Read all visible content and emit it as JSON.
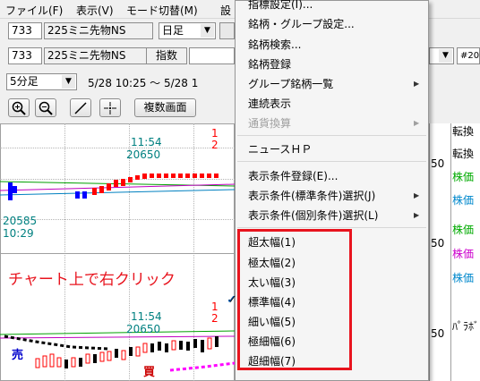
{
  "menubar": {
    "items": [
      "ファイル(F)",
      "表示(V)",
      "モード切替(M)",
      "設"
    ]
  },
  "toolbar1": {
    "code": "733",
    "name": "225ミニ先物NS",
    "period": "日足"
  },
  "toolbar2": {
    "code": "733",
    "name": "225ミニ先物NS",
    "type": "指数",
    "right_value": "#20"
  },
  "toolbar3": {
    "interval": "5分足",
    "range": "5/28 10:25 ～ 5/28 1"
  },
  "toolbar4": {
    "multi_screen": "複数画面"
  },
  "chart_top": {
    "time": "11:54",
    "price": "20650",
    "low_price": "20585",
    "low_time": "10:29",
    "side_value": "50",
    "side_value_2": "50",
    "red_char": "1",
    "red_char_2": "2"
  },
  "chart_bottom": {
    "time": "11:54",
    "price": "20650",
    "sell": "売",
    "buy": "買",
    "red_char": "1",
    "red_char_2": "2"
  },
  "annotation": "チャート上で右クリック",
  "context_menu": {
    "items": [
      {
        "label": "指標設定(I)...",
        "disabled": false,
        "submenu": false
      },
      {
        "label": "銘柄・グループ設定...",
        "disabled": false,
        "submenu": false
      },
      {
        "label": "銘柄検索...",
        "disabled": false,
        "submenu": false
      },
      {
        "label": "銘柄登録",
        "disabled": false,
        "submenu": false
      },
      {
        "label": "グループ銘柄一覧",
        "disabled": false,
        "submenu": true
      },
      {
        "label": "連続表示",
        "disabled": false,
        "submenu": false
      },
      {
        "label": "通貨換算",
        "disabled": true,
        "submenu": true
      },
      {
        "label": "ニュースＨＰ",
        "disabled": false,
        "submenu": false
      },
      {
        "label": "表示条件登録(E)...",
        "disabled": false,
        "submenu": false
      },
      {
        "label": "表示条件(標準条件)選択(J)",
        "disabled": false,
        "submenu": true
      },
      {
        "label": "表示条件(個別条件)選択(L)",
        "disabled": false,
        "submenu": true
      },
      {
        "label": "超太幅(1)",
        "disabled": false,
        "submenu": false
      },
      {
        "label": "極太幅(2)",
        "disabled": false,
        "submenu": false
      },
      {
        "label": "太い幅(3)",
        "disabled": false,
        "submenu": false
      },
      {
        "label": "標準幅(4)",
        "disabled": false,
        "submenu": false,
        "checked": true
      },
      {
        "label": "細い幅(5)",
        "disabled": false,
        "submenu": false
      },
      {
        "label": "極細幅(6)",
        "disabled": false,
        "submenu": false
      },
      {
        "label": "超細幅(7)",
        "disabled": false,
        "submenu": false
      }
    ],
    "check_mark": "✓",
    "submenu_arrow": "▶"
  },
  "right_panel": {
    "rows": [
      {
        "label": "転換",
        "color": "#000000"
      },
      {
        "label": "転換",
        "color": "#000000"
      },
      {
        "label": "株価",
        "color": "#00aa00"
      },
      {
        "label": "株価",
        "color": "#0088cc"
      },
      {
        "label": "株価",
        "color": "#00aa00"
      },
      {
        "label": "株価",
        "color": "#cc00cc"
      },
      {
        "label": "株価",
        "color": "#0088cc"
      },
      {
        "label": "ﾊﾟﾗﾎﾞ",
        "color": "#000000"
      }
    ]
  },
  "colors": {
    "highlight_box": "#e8141e",
    "annotation_text": "#e8141e",
    "bull_candle": "#ff0000",
    "bear_candle": "#0000ff",
    "time_label": "#008080"
  }
}
